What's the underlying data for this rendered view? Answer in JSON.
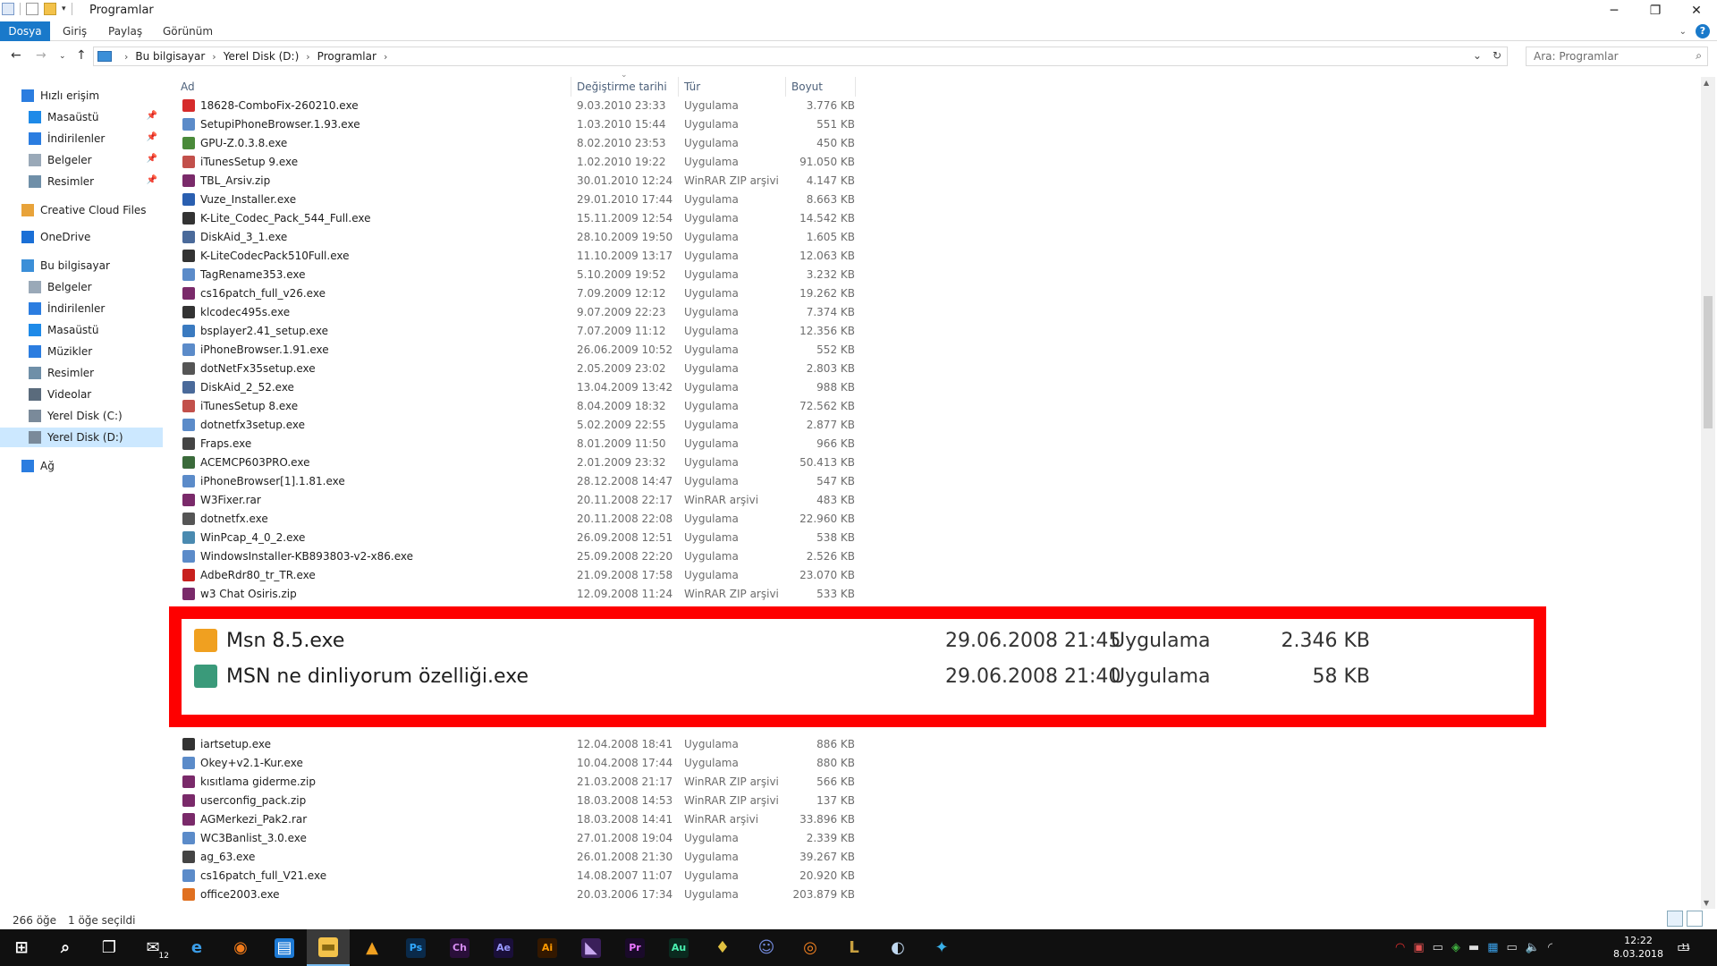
{
  "window": {
    "title": "Programlar",
    "controls": [
      "─",
      "❐",
      "✕"
    ]
  },
  "ribbon": {
    "tabs": [
      "Dosya",
      "Giriş",
      "Paylaş",
      "Görünüm"
    ]
  },
  "address": {
    "crumbs": [
      "Bu bilgisayar",
      "Yerel Disk (D:)",
      "Programlar"
    ],
    "search_placeholder": "Ara: Programlar"
  },
  "nav": {
    "items": [
      {
        "label": "Hızlı erişim",
        "icon": "star-icon",
        "color": "#2b7de0",
        "indent": 0,
        "pinned": false,
        "selected": false
      },
      {
        "label": "Masaüstü",
        "icon": "desktop-icon",
        "color": "#1e8ae8",
        "indent": 1,
        "pinned": true,
        "selected": false
      },
      {
        "label": "İndirilenler",
        "icon": "download-icon",
        "color": "#2b7de0",
        "indent": 1,
        "pinned": true,
        "selected": false
      },
      {
        "label": "Belgeler",
        "icon": "document-icon",
        "color": "#9aa9b8",
        "indent": 1,
        "pinned": true,
        "selected": false
      },
      {
        "label": "Resimler",
        "icon": "pictures-icon",
        "color": "#6f8fa8",
        "indent": 1,
        "pinned": true,
        "selected": false
      },
      {
        "label": "Creative Cloud Files",
        "icon": "creative-cloud-icon",
        "color": "#e8a33a",
        "indent": 0,
        "pinned": false,
        "selected": false
      },
      {
        "label": "OneDrive",
        "icon": "cloud-icon",
        "color": "#1a6fd6",
        "indent": 0,
        "pinned": false,
        "selected": false
      },
      {
        "label": "Bu bilgisayar",
        "icon": "computer-icon",
        "color": "#3b8fd8",
        "indent": 0,
        "pinned": false,
        "selected": false
      },
      {
        "label": "Belgeler",
        "icon": "document-icon",
        "color": "#9aa9b8",
        "indent": 1,
        "pinned": false,
        "selected": false
      },
      {
        "label": "İndirilenler",
        "icon": "download-icon",
        "color": "#2b7de0",
        "indent": 1,
        "pinned": false,
        "selected": false
      },
      {
        "label": "Masaüstü",
        "icon": "desktop-icon",
        "color": "#1e8ae8",
        "indent": 1,
        "pinned": false,
        "selected": false
      },
      {
        "label": "Müzikler",
        "icon": "music-icon",
        "color": "#2b7de0",
        "indent": 1,
        "pinned": false,
        "selected": false
      },
      {
        "label": "Resimler",
        "icon": "pictures-icon",
        "color": "#6f8fa8",
        "indent": 1,
        "pinned": false,
        "selected": false
      },
      {
        "label": "Videolar",
        "icon": "video-icon",
        "color": "#5a6b7c",
        "indent": 1,
        "pinned": false,
        "selected": false
      },
      {
        "label": "Yerel Disk (C:)",
        "icon": "drive-icon",
        "color": "#7a8a9a",
        "indent": 1,
        "pinned": false,
        "selected": false
      },
      {
        "label": "Yerel Disk (D:)",
        "icon": "drive-icon",
        "color": "#7a8a9a",
        "indent": 1,
        "pinned": false,
        "selected": true
      },
      {
        "label": "Ağ",
        "icon": "network-icon",
        "color": "#2b7de0",
        "indent": 0,
        "pinned": false,
        "selected": false
      }
    ]
  },
  "columns": {
    "name": "Ad",
    "date": "Değiştirme tarihi",
    "type": "Tür",
    "size": "Boyut"
  },
  "files_top": [
    {
      "name": "18628-ComboFix-260210.exe",
      "date": "9.03.2010 23:33",
      "type": "Uygulama",
      "size": "3.776 KB",
      "icon": "combofix-icon",
      "color": "#d62b2b"
    },
    {
      "name": "SetupiPhoneBrowser.1.93.exe",
      "date": "1.03.2010 15:44",
      "type": "Uygulama",
      "size": "551 KB",
      "icon": "installer-icon",
      "color": "#5b8bc9"
    },
    {
      "name": "GPU-Z.0.3.8.exe",
      "date": "8.02.2010 23:53",
      "type": "Uygulama",
      "size": "450 KB",
      "icon": "gpu-z-icon",
      "color": "#4a8a3a"
    },
    {
      "name": "iTunesSetup 9.exe",
      "date": "1.02.2010 19:22",
      "type": "Uygulama",
      "size": "91.050 KB",
      "icon": "itunes-icon",
      "color": "#c2504b"
    },
    {
      "name": "TBL_Arsiv.zip",
      "date": "30.01.2010 12:24",
      "type": "WinRAR ZIP arşivi",
      "size": "4.147 KB",
      "icon": "winrar-icon",
      "color": "#7a2a6a"
    },
    {
      "name": "Vuze_Installer.exe",
      "date": "29.01.2010 17:44",
      "type": "Uygulama",
      "size": "8.663 KB",
      "icon": "vuze-icon",
      "color": "#2a5fb0"
    },
    {
      "name": "K-Lite_Codec_Pack_544_Full.exe",
      "date": "15.11.2009 12:54",
      "type": "Uygulama",
      "size": "14.542 KB",
      "icon": "klite-icon",
      "color": "#333333"
    },
    {
      "name": "DiskAid_3_1.exe",
      "date": "28.10.2009 19:50",
      "type": "Uygulama",
      "size": "1.605 KB",
      "icon": "diskaid-icon",
      "color": "#4a6a9a"
    },
    {
      "name": "K-LiteCodecPack510Full.exe",
      "date": "11.10.2009 13:17",
      "type": "Uygulama",
      "size": "12.063 KB",
      "icon": "klite-icon",
      "color": "#333333"
    },
    {
      "name": "TagRename353.exe",
      "date": "5.10.2009 19:52",
      "type": "Uygulama",
      "size": "3.232 KB",
      "icon": "installer-icon",
      "color": "#5b8bc9"
    },
    {
      "name": "cs16patch_full_v26.exe",
      "date": "7.09.2009 12:12",
      "type": "Uygulama",
      "size": "19.262 KB",
      "icon": "winrar-icon",
      "color": "#7a2a6a"
    },
    {
      "name": "klcodec495s.exe",
      "date": "9.07.2009 22:23",
      "type": "Uygulama",
      "size": "7.374 KB",
      "icon": "klite-icon",
      "color": "#333333"
    },
    {
      "name": "bsplayer2.41_setup.exe",
      "date": "7.07.2009 11:12",
      "type": "Uygulama",
      "size": "12.356 KB",
      "icon": "bsplayer-icon",
      "color": "#3a7ac0"
    },
    {
      "name": "iPhoneBrowser.1.91.exe",
      "date": "26.06.2009 10:52",
      "type": "Uygulama",
      "size": "552 KB",
      "icon": "installer-icon",
      "color": "#5b8bc9"
    },
    {
      "name": "dotNetFx35setup.exe",
      "date": "2.05.2009 23:02",
      "type": "Uygulama",
      "size": "2.803 KB",
      "icon": "dotnet-icon",
      "color": "#555555"
    },
    {
      "name": "DiskAid_2_52.exe",
      "date": "13.04.2009 13:42",
      "type": "Uygulama",
      "size": "988 KB",
      "icon": "diskaid-icon",
      "color": "#4a6a9a"
    },
    {
      "name": "iTunesSetup 8.exe",
      "date": "8.04.2009 18:32",
      "type": "Uygulama",
      "size": "72.562 KB",
      "icon": "itunes-icon",
      "color": "#c2504b"
    },
    {
      "name": "dotnetfx3setup.exe",
      "date": "5.02.2009 22:55",
      "type": "Uygulama",
      "size": "2.877 KB",
      "icon": "installer-icon",
      "color": "#5b8bc9"
    },
    {
      "name": "Fraps.exe",
      "date": "8.01.2009 11:50",
      "type": "Uygulama",
      "size": "966 KB",
      "icon": "fraps-icon",
      "color": "#444444"
    },
    {
      "name": "ACEMCP603PRO.exe",
      "date": "2.01.2009 23:32",
      "type": "Uygulama",
      "size": "50.413 KB",
      "icon": "ace-icon",
      "color": "#3a6a3a"
    },
    {
      "name": "iPhoneBrowser[1].1.81.exe",
      "date": "28.12.2008 14:47",
      "type": "Uygulama",
      "size": "547 KB",
      "icon": "installer-icon",
      "color": "#5b8bc9"
    },
    {
      "name": "W3Fixer.rar",
      "date": "20.11.2008 22:17",
      "type": "WinRAR arşivi",
      "size": "483 KB",
      "icon": "winrar-icon",
      "color": "#7a2a6a"
    },
    {
      "name": "dotnetfx.exe",
      "date": "20.11.2008 22:08",
      "type": "Uygulama",
      "size": "22.960 KB",
      "icon": "dotnet-icon",
      "color": "#555555"
    },
    {
      "name": "WinPcap_4_0_2.exe",
      "date": "26.09.2008 12:51",
      "type": "Uygulama",
      "size": "538 KB",
      "icon": "winpcap-icon",
      "color": "#4a8ab0"
    },
    {
      "name": "WindowsInstaller-KB893803-v2-x86.exe",
      "date": "25.09.2008 22:20",
      "type": "Uygulama",
      "size": "2.526 KB",
      "icon": "installer-icon",
      "color": "#5b8bc9"
    },
    {
      "name": "AdbeRdr80_tr_TR.exe",
      "date": "21.09.2008 17:58",
      "type": "Uygulama",
      "size": "23.070 KB",
      "icon": "adobe-reader-icon",
      "color": "#c8201e"
    },
    {
      "name": "w3 Chat Osiris.zip",
      "date": "12.09.2008 11:24",
      "type": "WinRAR ZIP arşivi",
      "size": "533 KB",
      "icon": "winrar-icon",
      "color": "#7a2a6a"
    }
  ],
  "files_highlight": [
    {
      "name": "Msn 8.5.exe",
      "date": "29.06.2008 21:45",
      "type": "Uygulama",
      "size": "2.346 KB",
      "icon": "windows-flag-icon",
      "color": "#f0a020"
    },
    {
      "name": "MSN ne dinliyorum özelliği.exe",
      "date": "29.06.2008 21:40",
      "type": "Uygulama",
      "size": "58 KB",
      "icon": "msn-globe-icon",
      "color": "#3a9a7a"
    }
  ],
  "files_bottom": [
    {
      "name": "iartsetup.exe",
      "date": "12.04.2008 18:41",
      "type": "Uygulama",
      "size": "886 KB",
      "icon": "installer-icon",
      "color": "#333333"
    },
    {
      "name": "Okey+v2.1-Kur.exe",
      "date": "10.04.2008 17:44",
      "type": "Uygulama",
      "size": "880 KB",
      "icon": "installer-icon",
      "color": "#5b8bc9"
    },
    {
      "name": "kısıtlama giderme.zip",
      "date": "21.03.2008 21:17",
      "type": "WinRAR ZIP arşivi",
      "size": "566 KB",
      "icon": "winrar-icon",
      "color": "#7a2a6a"
    },
    {
      "name": "userconfig_pack.zip",
      "date": "18.03.2008 14:53",
      "type": "WinRAR ZIP arşivi",
      "size": "137 KB",
      "icon": "winrar-icon",
      "color": "#7a2a6a"
    },
    {
      "name": "AGMerkezi_Pak2.rar",
      "date": "18.03.2008 14:41",
      "type": "WinRAR arşivi",
      "size": "33.896 KB",
      "icon": "winrar-icon",
      "color": "#7a2a6a"
    },
    {
      "name": "WC3Banlist_3.0.exe",
      "date": "27.01.2008 19:04",
      "type": "Uygulama",
      "size": "2.339 KB",
      "icon": "installer-icon",
      "color": "#5b8bc9"
    },
    {
      "name": "ag_63.exe",
      "date": "26.01.2008 21:30",
      "type": "Uygulama",
      "size": "39.267 KB",
      "icon": "installer-icon",
      "color": "#444444"
    },
    {
      "name": "cs16patch_full_V21.exe",
      "date": "14.08.2007 11:07",
      "type": "Uygulama",
      "size": "20.920 KB",
      "icon": "installer-icon",
      "color": "#5b8bc9"
    },
    {
      "name": "office2003.exe",
      "date": "20.03.2006 17:34",
      "type": "Uygulama",
      "size": "203.879 KB",
      "icon": "office-icon",
      "color": "#e07020"
    }
  ],
  "status": {
    "count": "266 öğe",
    "selected": "1 öğe seçildi"
  },
  "taskbar": {
    "apps": [
      {
        "name": "start-button",
        "glyph": "⊞",
        "bg": "transparent",
        "fg": "#ffffff",
        "active": false
      },
      {
        "name": "search-button",
        "glyph": "⌕",
        "bg": "transparent",
        "fg": "#ffffff",
        "active": false
      },
      {
        "name": "task-view-button",
        "glyph": "❐",
        "bg": "transparent",
        "fg": "#ffffff",
        "active": false
      },
      {
        "name": "mail-app",
        "glyph": "✉",
        "bg": "transparent",
        "fg": "#ffffff",
        "active": false,
        "badge": "12"
      },
      {
        "name": "edge-app",
        "glyph": "e",
        "bg": "transparent",
        "fg": "#3b9de8",
        "active": false
      },
      {
        "name": "firefox-app",
        "glyph": "◉",
        "bg": "transparent",
        "fg": "#f07a1a",
        "active": false
      },
      {
        "name": "store-app",
        "glyph": "▤",
        "bg": "#1e7ad4",
        "fg": "#ffffff",
        "active": false
      },
      {
        "name": "file-explorer-app",
        "glyph": "▬",
        "bg": "#f3c24a",
        "fg": "#8a6a10",
        "active": true
      },
      {
        "name": "autodesk-app",
        "glyph": "▲",
        "bg": "transparent",
        "fg": "#f0a020",
        "active": false
      },
      {
        "name": "photoshop-app",
        "glyph": "Ps",
        "bg": "#0a2a4a",
        "fg": "#31a8ff",
        "active": false
      },
      {
        "name": "character-animator-app",
        "glyph": "Ch",
        "bg": "#2a0f3a",
        "fg": "#d58cf0",
        "active": false
      },
      {
        "name": "after-effects-app",
        "glyph": "Ae",
        "bg": "#1a0f3a",
        "fg": "#9999ff",
        "active": false
      },
      {
        "name": "illustrator-app",
        "glyph": "Ai",
        "bg": "#331800",
        "fg": "#ff9a00",
        "active": false
      },
      {
        "name": "visual-studio-app",
        "glyph": "◣",
        "bg": "#3a1f5a",
        "fg": "#c8a8f0",
        "active": false
      },
      {
        "name": "premiere-app",
        "glyph": "Pr",
        "bg": "#1a0a2a",
        "fg": "#ea77ff",
        "active": false
      },
      {
        "name": "audition-app",
        "glyph": "Au",
        "bg": "#0a2a1f",
        "fg": "#4af0b0",
        "active": false
      },
      {
        "name": "app-torch",
        "glyph": "♦",
        "bg": "transparent",
        "fg": "#e0c040",
        "active": false
      },
      {
        "name": "discord-app",
        "glyph": "☺",
        "bg": "transparent",
        "fg": "#7289da",
        "active": false
      },
      {
        "name": "blender-app",
        "glyph": "◎",
        "bg": "transparent",
        "fg": "#f08020",
        "active": false
      },
      {
        "name": "league-app",
        "glyph": "L",
        "bg": "transparent",
        "fg": "#c8a040",
        "active": false
      },
      {
        "name": "steam-app",
        "glyph": "◐",
        "bg": "transparent",
        "fg": "#c0d8f0",
        "active": false
      },
      {
        "name": "app-swirl",
        "glyph": "✦",
        "bg": "transparent",
        "fg": "#3ab0e8",
        "active": false
      }
    ],
    "tray": [
      {
        "name": "creative-cloud-tray-icon",
        "glyph": "◠",
        "color": "#e83030"
      },
      {
        "name": "tray-app-red-icon",
        "glyph": "▣",
        "color": "#e05050"
      },
      {
        "name": "keyboard-tray-icon",
        "glyph": "▭",
        "color": "#dddddd"
      },
      {
        "name": "shield-tray-icon",
        "glyph": "◈",
        "color": "#40b040"
      },
      {
        "name": "battery-tray-icon",
        "glyph": "▬",
        "color": "#dddddd"
      },
      {
        "name": "tray-blue-icon",
        "glyph": "▦",
        "color": "#3aa0e8"
      },
      {
        "name": "display-tray-icon",
        "glyph": "▭",
        "color": "#dddddd"
      },
      {
        "name": "volume-tray-icon",
        "glyph": "🔈",
        "color": "#dddddd"
      },
      {
        "name": "wifi-tray-icon",
        "glyph": "◜",
        "color": "#dddddd"
      }
    ],
    "time": "12:22",
    "date": "8.03.2018",
    "notification_count": "11"
  }
}
